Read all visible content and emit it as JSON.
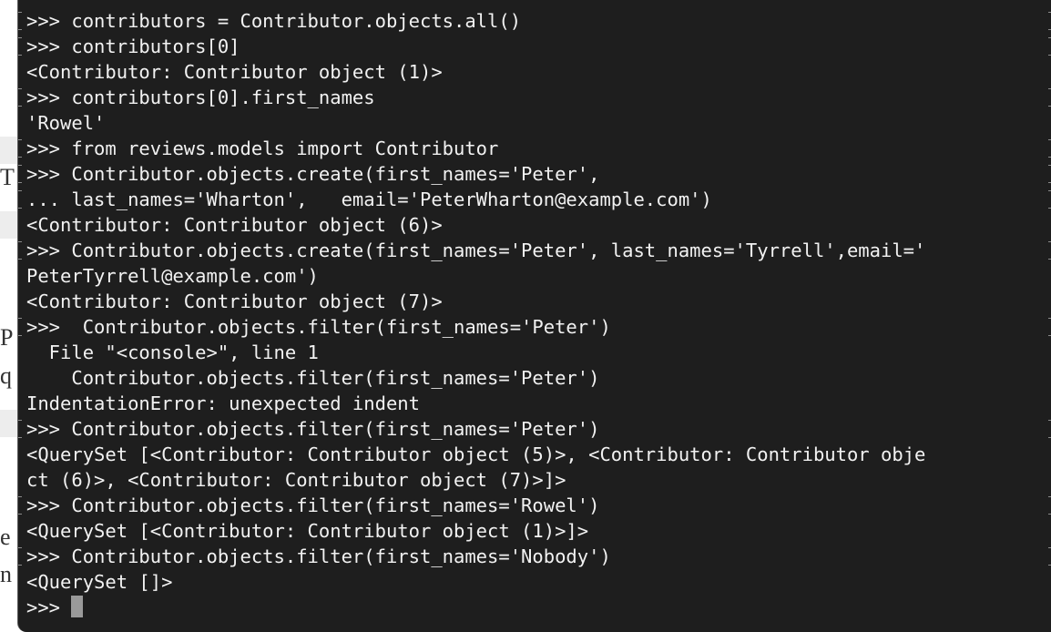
{
  "background_document": {
    "letters": [
      "T",
      "P",
      "q",
      "e",
      "n"
    ]
  },
  "terminal": {
    "cursor_color": "#9a9a9a",
    "background_color": "#1e1e1e",
    "text_color": "#f2f2f2",
    "lines": [
      {
        "text": ">>> contributors = Contributor.objects.all()",
        "marked": true
      },
      {
        "text": ">>> contributors[0]",
        "marked": true
      },
      {
        "text": "<Contributor: Contributor object (1)>",
        "marked": false
      },
      {
        "text": ">>> contributors[0].first_names",
        "marked": true
      },
      {
        "text": "'Rowel'",
        "marked": false
      },
      {
        "text": ">>> from reviews.models import Contributor",
        "marked": true
      },
      {
        "text": ">>> Contributor.objects.create(first_names='Peter',",
        "marked": true
      },
      {
        "text": "... last_names='Wharton',   email='PeterWharton@example.com')",
        "marked": true
      },
      {
        "text": "<Contributor: Contributor object (6)>",
        "marked": false
      },
      {
        "text": ">>> Contributor.objects.create(first_names='Peter', last_names='Tyrrell',email='",
        "marked": true
      },
      {
        "text": "PeterTyrrell@example.com')",
        "marked": false
      },
      {
        "text": "<Contributor: Contributor object (7)>",
        "marked": false
      },
      {
        "text": ">>>  Contributor.objects.filter(first_names='Peter')",
        "marked": true
      },
      {
        "text": "  File \"<console>\", line 1",
        "marked": false
      },
      {
        "text": "    Contributor.objects.filter(first_names='Peter')",
        "marked": false
      },
      {
        "text": "IndentationError: unexpected indent",
        "marked": false
      },
      {
        "text": ">>> Contributor.objects.filter(first_names='Peter')",
        "marked": true
      },
      {
        "text": "<QuerySet [<Contributor: Contributor object (5)>, <Contributor: Contributor obje",
        "marked": false
      },
      {
        "text": "ct (6)>, <Contributor: Contributor object (7)>]>",
        "marked": false
      },
      {
        "text": ">>> Contributor.objects.filter(first_names='Rowel')",
        "marked": true
      },
      {
        "text": "<QuerySet [<Contributor: Contributor object (1)>]>",
        "marked": false
      },
      {
        "text": ">>> Contributor.objects.filter(first_names='Nobody')",
        "marked": true
      },
      {
        "text": "<QuerySet []>",
        "marked": false
      }
    ],
    "prompt": ">>>"
  }
}
